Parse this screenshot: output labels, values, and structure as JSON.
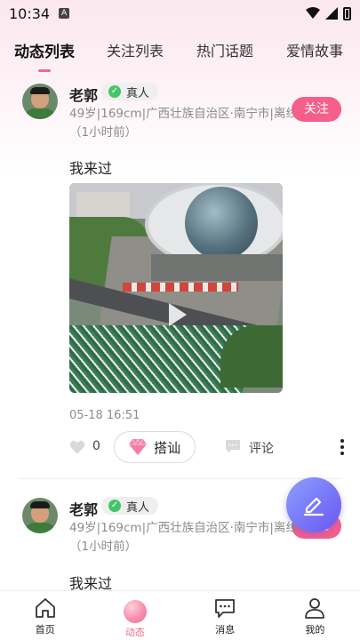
{
  "status_bar": {
    "time": "10:34",
    "notification": "A"
  },
  "tabs": [
    {
      "label": "动态列表",
      "active": true
    },
    {
      "label": "关注列表",
      "active": false
    },
    {
      "label": "热门话题",
      "active": false
    },
    {
      "label": "爱情故事",
      "active": false
    }
  ],
  "posts": [
    {
      "name": "老郭",
      "verified_label": "真人",
      "info_line1": "49岁|169cm|广西壮族自治区·南宁市|离线",
      "info_line2": "（1小时前）",
      "follow_label": "关注",
      "text": "我来过",
      "date": "05-18 16:51",
      "likes": "0",
      "chat_label": "搭讪",
      "comment_label": "评论"
    },
    {
      "name": "老郭",
      "verified_label": "真人",
      "info_line1": "49岁|169cm|广西壮族自治区·南宁市|离线",
      "info_line2": "（1小时前）",
      "follow_label": "关注",
      "text": "我来过"
    }
  ],
  "bottom_nav": [
    {
      "label": "首页",
      "icon": "home-icon"
    },
    {
      "label": "动态",
      "icon": "moments-icon",
      "active": true
    },
    {
      "label": "消息",
      "icon": "message-icon"
    },
    {
      "label": "我的",
      "icon": "profile-icon"
    }
  ],
  "colors": {
    "accent": "#f55f8a",
    "fab": "#7a6cf5",
    "verified": "#45c56a"
  }
}
